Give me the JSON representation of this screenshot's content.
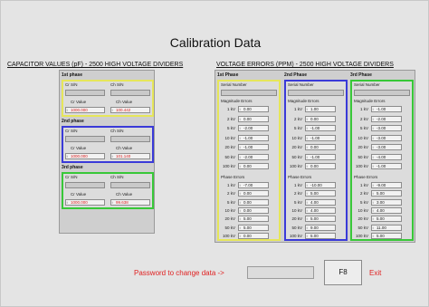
{
  "title": "Calibration Data",
  "cap_section_title": "CAPACITOR VALUES (pF) - 2500 HIGH VOLTAGE DIVIDERS",
  "volt_section_title": "VOLTAGE ERRORS (PPM) - 2500 HIGH VOLTAGE DIVIDERS",
  "cap_phases": [
    {
      "name": "1st phase",
      "cr_sn_label": "Cr S/N",
      "ch_sn_label": "Ch S/N",
      "cr_value_label": "Cr Value",
      "ch_value_label": "Ch Value",
      "cr_value": "1000.000",
      "ch_value": "100.442"
    },
    {
      "name": "2nd phase",
      "cr_sn_label": "Cr S/N",
      "ch_sn_label": "Ch S/N",
      "cr_value_label": "Cr Value",
      "ch_value_label": "Ch Value",
      "cr_value": "1000.000",
      "ch_value": "101.140"
    },
    {
      "name": "3rd phase",
      "cr_sn_label": "Cr S/N",
      "ch_sn_label": "Ch S/N",
      "cr_value_label": "Cr Value",
      "ch_value_label": "Ch Value",
      "cr_value": "1000.000",
      "ch_value": "99.638"
    }
  ],
  "volt_phases": [
    {
      "name": "1st Phase",
      "serial_label": "Serial Number",
      "mag_label": "Magnitude Errors",
      "phase_label": "Phase Errors",
      "mag_rows": [
        {
          "label": "1 kV",
          "value": "0.00"
        },
        {
          "label": "2 kV",
          "value": "0.00"
        },
        {
          "label": "5 kV",
          "value": "-2.00"
        },
        {
          "label": "10 kV",
          "value": "-1.00"
        },
        {
          "label": "20 kV",
          "value": "-1.00"
        },
        {
          "label": "50 kV",
          "value": "-2.00"
        },
        {
          "label": "100 kV",
          "value": "0.00"
        }
      ],
      "phase_rows": [
        {
          "label": "1 kV",
          "value": "-7.00"
        },
        {
          "label": "2 kV",
          "value": "0.00"
        },
        {
          "label": "5 kV",
          "value": "0.00"
        },
        {
          "label": "10 kV",
          "value": "0.00"
        },
        {
          "label": "20 kV",
          "value": "5.00"
        },
        {
          "label": "50 kV",
          "value": "5.00"
        },
        {
          "label": "100 kV",
          "value": "0.00"
        }
      ]
    },
    {
      "name": "2nd Phase",
      "serial_label": "Serial Number",
      "mag_label": "Magnitude Errors",
      "phase_label": "Phase Errors",
      "mag_rows": [
        {
          "label": "1 kV",
          "value": "1.00"
        },
        {
          "label": "2 kV",
          "value": "0.00"
        },
        {
          "label": "5 kV",
          "value": "-1.00"
        },
        {
          "label": "10 kV",
          "value": "-1.00"
        },
        {
          "label": "20 kV",
          "value": "0.00"
        },
        {
          "label": "50 kV",
          "value": "-1.00"
        },
        {
          "label": "100 kV",
          "value": "0.00"
        }
      ],
      "phase_rows": [
        {
          "label": "1 kV",
          "value": "-10.00"
        },
        {
          "label": "2 kV",
          "value": "5.00"
        },
        {
          "label": "5 kV",
          "value": "4.00"
        },
        {
          "label": "10 kV",
          "value": "4.00"
        },
        {
          "label": "20 kV",
          "value": "5.00"
        },
        {
          "label": "50 kV",
          "value": "9.00"
        },
        {
          "label": "100 kV",
          "value": "5.00"
        }
      ]
    },
    {
      "name": "3rd Phase",
      "serial_label": "Serial Number",
      "mag_label": "Magnitude Errors",
      "phase_label": "Phase Errors",
      "mag_rows": [
        {
          "label": "1 kV",
          "value": "-1.00"
        },
        {
          "label": "2 kV",
          "value": "-2.00"
        },
        {
          "label": "5 kV",
          "value": "-3.00"
        },
        {
          "label": "10 kV",
          "value": "-3.00"
        },
        {
          "label": "20 kV",
          "value": "-3.00"
        },
        {
          "label": "50 kV",
          "value": "-4.00"
        },
        {
          "label": "100 kV",
          "value": "-1.00"
        }
      ],
      "phase_rows": [
        {
          "label": "1 kV",
          "value": "-9.00"
        },
        {
          "label": "2 kV",
          "value": "5.00"
        },
        {
          "label": "5 kV",
          "value": "3.00"
        },
        {
          "label": "10 kV",
          "value": "4.00"
        },
        {
          "label": "20 kV",
          "value": "5.00"
        },
        {
          "label": "50 kV",
          "value": "11.00"
        },
        {
          "label": "100 kV",
          "value": "5.00"
        }
      ]
    }
  ],
  "password_label": "Password to change data ->",
  "f8_label": "F8",
  "exit_label": "Exit",
  "colors": {
    "phase1": "#e6e65a",
    "phase2": "#3a3ad8",
    "phase3": "#38c838",
    "alert": "#e02020"
  }
}
